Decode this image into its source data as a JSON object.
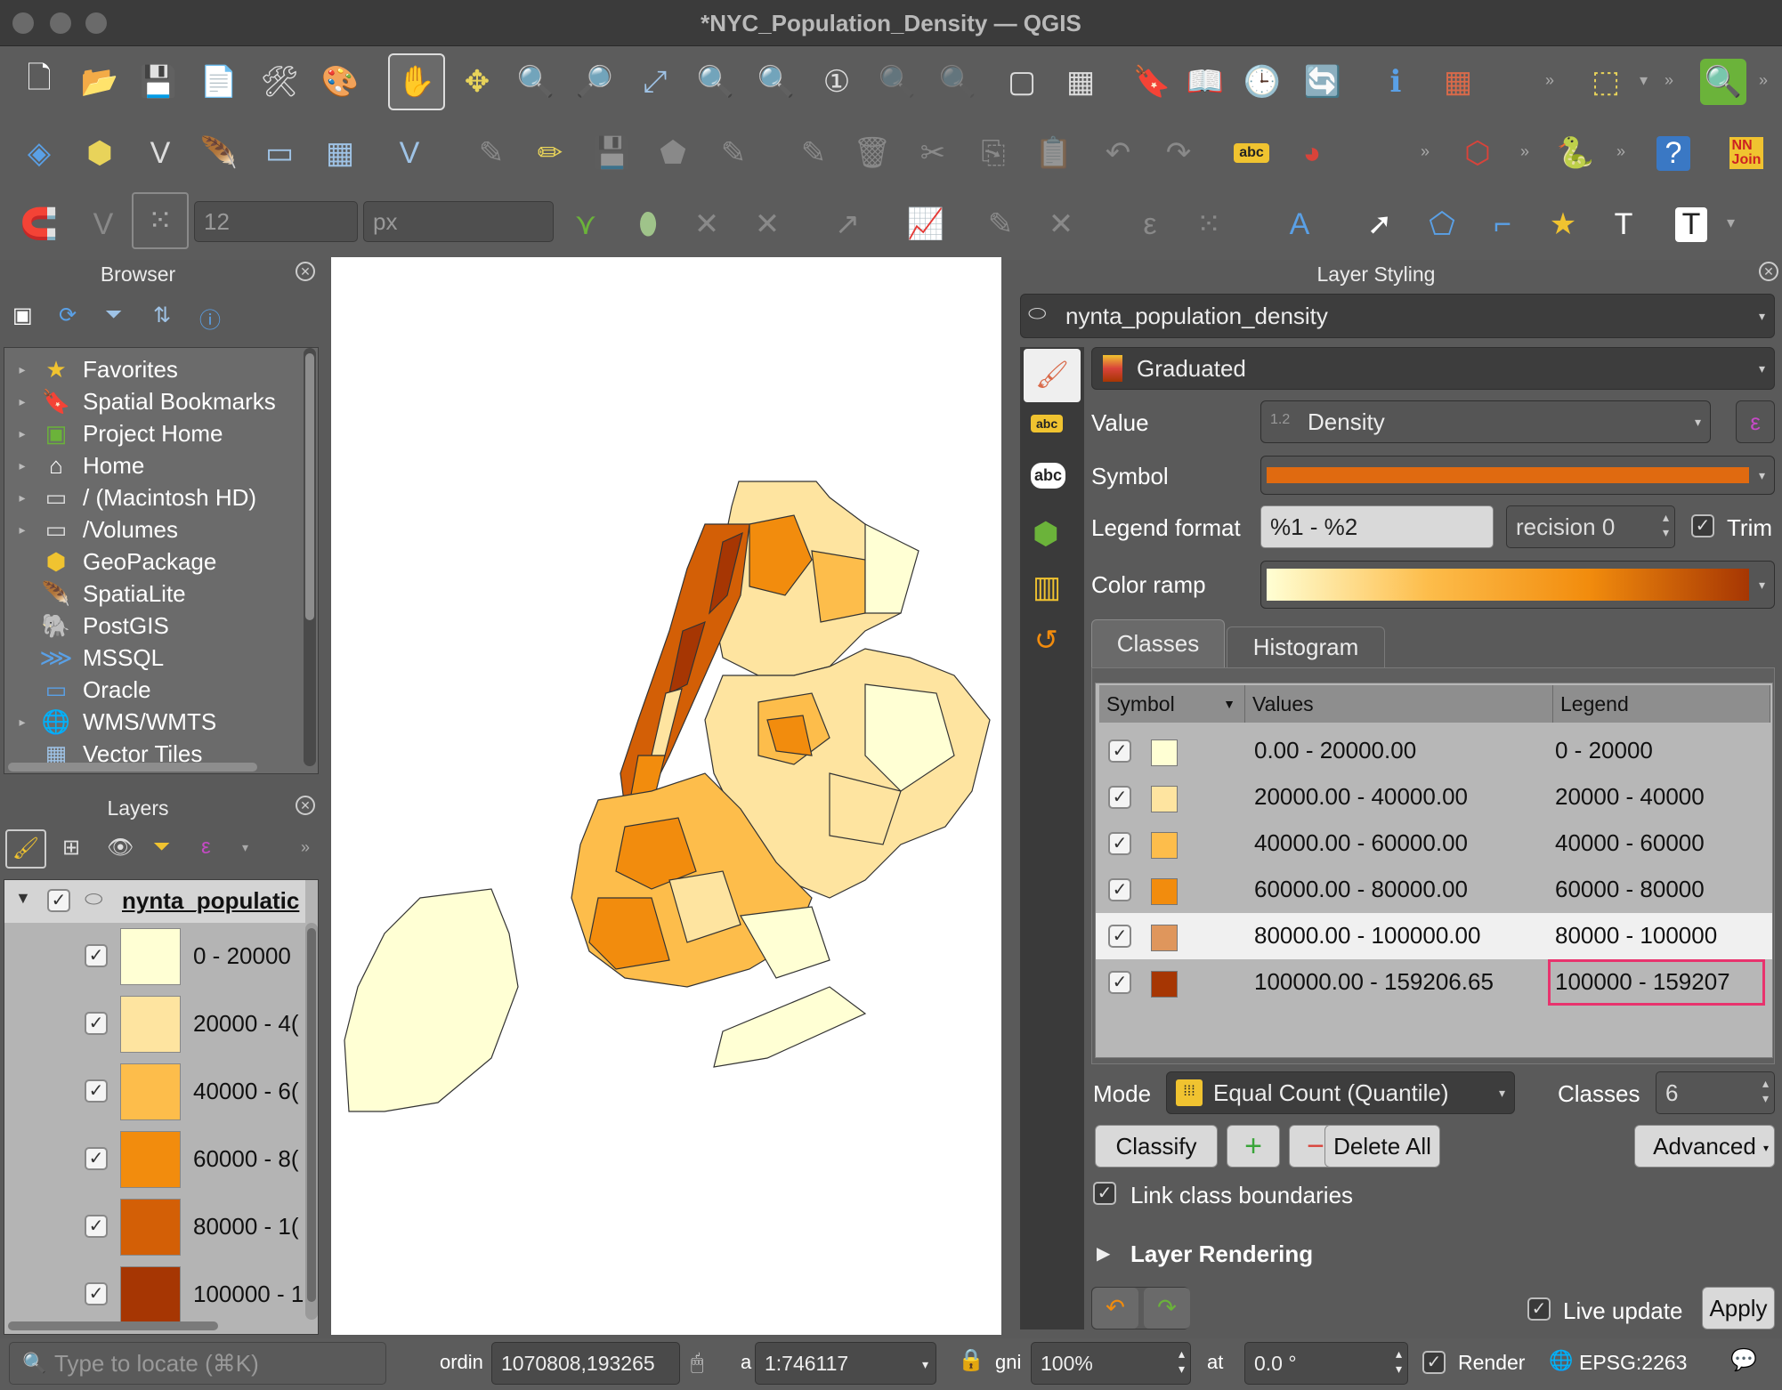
{
  "window": {
    "title": "*NYC_Population_Density — QGIS"
  },
  "toolbar3": {
    "snap_tolerance": "12",
    "snap_units": "px"
  },
  "browser": {
    "title": "Browser",
    "items": [
      {
        "label": "Favorites",
        "icon": "star-icon",
        "expand": true
      },
      {
        "label": "Spatial Bookmarks",
        "icon": "bookmark-icon",
        "expand": true
      },
      {
        "label": "Project Home",
        "icon": "project-home-icon",
        "expand": true
      },
      {
        "label": "Home",
        "icon": "home-icon",
        "expand": true
      },
      {
        "label": "/ (Macintosh HD)",
        "icon": "folder-icon",
        "expand": true
      },
      {
        "label": "/Volumes",
        "icon": "folder-icon",
        "expand": true
      },
      {
        "label": "GeoPackage",
        "icon": "geopackage-icon",
        "expand": false
      },
      {
        "label": "SpatiaLite",
        "icon": "spatialite-icon",
        "expand": false
      },
      {
        "label": "PostGIS",
        "icon": "postgis-icon",
        "expand": false
      },
      {
        "label": "MSSQL",
        "icon": "mssql-icon",
        "expand": false
      },
      {
        "label": "Oracle",
        "icon": "oracle-icon",
        "expand": false
      },
      {
        "label": "WMS/WMTS",
        "icon": "wms-icon",
        "expand": true
      },
      {
        "label": "Vector Tiles",
        "icon": "vector-tiles-icon",
        "expand": false
      }
    ]
  },
  "layers": {
    "title": "Layers",
    "layer_name": "nynta_populatic",
    "legend": [
      {
        "label": "0 - 20000",
        "color": "#ffffd4"
      },
      {
        "label": "20000 - 4(",
        "color": "#fee4a0"
      },
      {
        "label": "40000 - 6(",
        "color": "#fdbd4b"
      },
      {
        "label": "60000 - 8(",
        "color": "#f28c0d"
      },
      {
        "label": "80000 - 1(",
        "color": "#d35f06"
      },
      {
        "label": "100000 - 1",
        "color": "#a63603"
      }
    ]
  },
  "styling": {
    "title": "Layer Styling",
    "layer": "nynta_population_density",
    "renderer": "Graduated",
    "value_label": "Value",
    "value": "Density",
    "symbol_label": "Symbol",
    "legend_format_label": "Legend format",
    "legend_format": "%1 - %2",
    "precision": "recision 0",
    "trim_label": "Trim",
    "color_ramp_label": "Color ramp",
    "tabs": [
      "Classes",
      "Histogram"
    ],
    "columns": [
      "Symbol",
      "Values",
      "Legend"
    ],
    "classes": [
      {
        "values": "0.00 - 20000.00",
        "legend": "0 - 20000",
        "color": "#ffffd4"
      },
      {
        "values": "20000.00 - 40000.00",
        "legend": "20000 - 40000",
        "color": "#fee4a0"
      },
      {
        "values": "40000.00 - 60000.00",
        "legend": "40000 - 60000",
        "color": "#fdbd4b"
      },
      {
        "values": "60000.00 - 80000.00",
        "legend": "60000 - 80000",
        "color": "#f28c0d"
      },
      {
        "values": "80000.00 - 100000.00",
        "legend": "80000 - 100000",
        "color": "#df965c"
      },
      {
        "values": "100000.00 - 159206.65",
        "legend": "100000 - 159207",
        "color": "#a63603"
      }
    ],
    "mode_label": "Mode",
    "mode": "Equal Count (Quantile)",
    "classes_label": "Classes",
    "classes_count": "6",
    "classify": "Classify",
    "delete_all": "Delete All",
    "advanced": "Advanced",
    "link_boundaries": "Link class boundaries",
    "layer_rendering": "Layer Rendering",
    "live_update": "Live update",
    "apply": "Apply",
    "highlight_color": "#e8336d"
  },
  "status": {
    "locate_placeholder": "Type to locate (⌘K)",
    "coord_label": "ordin",
    "coordinate": "1070808,193265",
    "scale_label": "a",
    "scale": "1:746117",
    "magnifier_label": "gni",
    "magnifier": "100%",
    "rotation_label": "at",
    "rotation": "0.0 °",
    "render": "Render",
    "crs": "EPSG:2263"
  }
}
